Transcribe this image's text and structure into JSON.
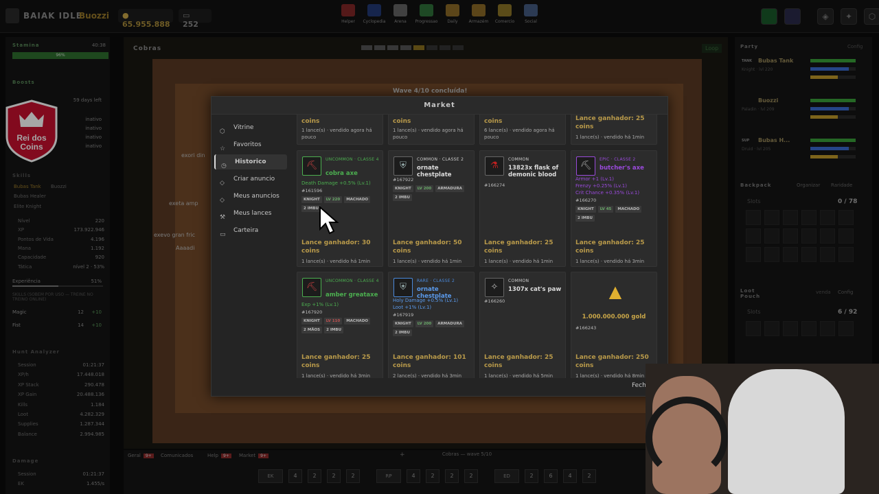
{
  "topbar": {
    "brand": "BAIAK IDLE",
    "player": "Buozzi",
    "gold": "65.955.888",
    "gems": "252",
    "nav": [
      {
        "label": "Helper",
        "icon": "heart-icon",
        "color": "#b03030"
      },
      {
        "label": "Cyclopedia",
        "icon": "book-icon",
        "color": "#2a4aa0"
      },
      {
        "label": "Arena",
        "icon": "swords-icon",
        "color": "#888888"
      },
      {
        "label": "Progressao",
        "icon": "chart-icon",
        "color": "#3a9a4a"
      },
      {
        "label": "Daily",
        "icon": "gift-icon",
        "color": "#c09030"
      },
      {
        "label": "Armazém",
        "icon": "chest-icon",
        "color": "#c09030"
      },
      {
        "label": "Comercio",
        "icon": "coins-icon",
        "color": "#c0a030"
      },
      {
        "label": "Social",
        "icon": "people-icon",
        "color": "#5a7ab0"
      }
    ]
  },
  "left": {
    "stamina_label": "Stamina",
    "stamina_time": "40:38",
    "stamina_pct": "96%",
    "boosts_label": "Boosts",
    "boost_days": "59 days left",
    "boost_states": [
      "inativo",
      "inativo",
      "inativo",
      "inativo"
    ],
    "skills_label": "Skills",
    "party_names": [
      "Bubas Tank",
      "Buozzi",
      "Bubas Healer"
    ],
    "vocation": "Elite Knight",
    "stats": [
      {
        "k": "Nível",
        "v": "220"
      },
      {
        "k": "XP",
        "v": "173.922.946"
      },
      {
        "k": "Pontos de Vida",
        "v": "4.196"
      },
      {
        "k": "Mana",
        "v": "1.192"
      },
      {
        "k": "Capacidade",
        "v": "920"
      },
      {
        "k": "Tática",
        "v": "nível 2 · 53%"
      }
    ],
    "exp_label": "Experiência",
    "exp_pct": "51%",
    "skills_note": "SKILLS (SOBEM POR USO — TREINE NO TREINO ONLINE)",
    "magic": {
      "k": "Magic",
      "v": "12",
      "bonus": "+10"
    },
    "fist": {
      "k": "Fist",
      "v": "14",
      "bonus": "+10"
    },
    "hunt_label": "Hunt Analyzer",
    "hunt": [
      {
        "k": "Session",
        "v": "01:21:37"
      },
      {
        "k": "XP/h",
        "v": "17.448.018"
      },
      {
        "k": "XP Stack",
        "v": "290.478"
      },
      {
        "k": "XP Gain",
        "v": "20.488.136"
      },
      {
        "k": "Kills",
        "v": "1.184"
      },
      {
        "k": "Loot",
        "v": "4.282.329"
      },
      {
        "k": "Supplies",
        "v": "1.287.344"
      },
      {
        "k": "Balance",
        "v": "2.994.985"
      }
    ],
    "damage_label": "Damage",
    "damage": [
      {
        "k": "Session",
        "v": "01:21:37"
      },
      {
        "k": "EK",
        "v": "1.455/s"
      }
    ]
  },
  "logo": {
    "line1": "Rei dos",
    "line2": "Coins"
  },
  "game": {
    "location": "Cobras",
    "wave_banner": "Wave 4/10 concluída!",
    "loop_label": "Loop",
    "overhead": [
      "exori din",
      "exeta amp",
      "exevo gran fric",
      "Aaaadi"
    ],
    "status_line": "Cobras — wave 5/10"
  },
  "right": {
    "party_label": "Party",
    "config_label": "Config",
    "members": [
      {
        "role": "TANK",
        "name": "Bubas Tank",
        "sub": "Knight · lvl 220"
      },
      {
        "role": "",
        "name": "Buozzi",
        "sub": "Paladin · lvl 209"
      },
      {
        "role": "SUP",
        "name": "Bubas H...",
        "sub": "Druid · lvl 205"
      }
    ],
    "backpack_label": "Backpack",
    "organizar": "Organizar",
    "raridade": "Raridade",
    "slots_label": "Slots",
    "backpack_slots": "0 / 78",
    "loot_label": "Loot Pouch",
    "venda": "venda",
    "loot_slots": "6 / 92",
    "config2": "Config"
  },
  "bottom": {
    "tabs": [
      {
        "label": "Geral",
        "badge": "9+"
      },
      {
        "label": "Comunicados",
        "badge": ""
      },
      {
        "label": "Help",
        "badge": "9+"
      },
      {
        "label": "Market",
        "badge": "9+"
      }
    ],
    "add_tab": "+",
    "hotkeys": [
      {
        "label": "EK",
        "nums": [
          "4",
          "2",
          "2",
          "2"
        ]
      },
      {
        "label": "RP",
        "nums": [
          "4",
          "2",
          "2",
          "2"
        ]
      },
      {
        "label": "ED",
        "nums": [
          "2",
          "6",
          "4",
          "2"
        ]
      }
    ]
  },
  "market": {
    "title": "Market",
    "close": "Fechar",
    "menu": [
      {
        "label": "Vitrine",
        "icon": "cube-icon"
      },
      {
        "label": "Favoritos",
        "icon": "star-icon"
      },
      {
        "label": "Historico",
        "icon": "clock-icon",
        "active": true
      },
      {
        "label": "Criar anuncio",
        "icon": "tag-icon"
      },
      {
        "label": "Meus anuncios",
        "icon": "tag-icon"
      },
      {
        "label": "Meus lances",
        "icon": "gavel-icon"
      },
      {
        "label": "Carteira",
        "icon": "wallet-icon"
      }
    ],
    "row0": [
      {
        "win": "coins",
        "meta": "1 lance(s) · vendido agora há pouco"
      },
      {
        "win": "coins",
        "meta": "1 lance(s) · vendido agora há pouco"
      },
      {
        "win": "coins",
        "meta": "6 lance(s) · vendido agora há pouco"
      },
      {
        "win": "Lance ganhador: 25 coins",
        "meta": "1 lance(s) · vendido há 1min"
      }
    ],
    "row1": [
      {
        "rarity": "UNCOMMON · CLASSE 4",
        "rarity_color": "#4caf50",
        "name": "cobra axe",
        "name_color": "#4caf50",
        "attrs": [
          "Death Damage +0.5% (Lv.1)"
        ],
        "id": "#161596",
        "tags": [
          "KNIGHT",
          "LV 220",
          "MACHADO",
          "2 IMBU"
        ],
        "win": "Lance ganhador: 30 coins",
        "meta": "1 lance(s) · vendido há 1min",
        "icon": "axe-icon",
        "icon_color": "#c04040",
        "border": "#4caf50"
      },
      {
        "rarity": "COMMON · CLASSE 2",
        "rarity_color": "#cfcfcf",
        "name": "ornate chestplate",
        "name_color": "#dcdcdc",
        "attrs": [],
        "id": "#167922",
        "tags": [
          "KNIGHT",
          "LV 200",
          "ARMADURA",
          "2 IMBU"
        ],
        "win": "Lance ganhador: 50 coins",
        "meta": "1 lance(s) · vendido há 1min",
        "icon": "armor-icon",
        "icon_color": "#9ab0b0",
        "border": "#666666"
      },
      {
        "rarity": "COMMON",
        "rarity_color": "#cfcfcf",
        "name": "13823x flask of demonic blood",
        "name_color": "#dcdcdc",
        "attrs": [],
        "id": "#166274",
        "tags": [],
        "win": "Lance ganhador: 25 coins",
        "meta": "1 lance(s) · vendido há 1min",
        "icon": "flask-icon",
        "icon_color": "#c02020",
        "border": "#666666"
      },
      {
        "rarity": "EPIC · CLASSE 2",
        "rarity_color": "#9a4adc",
        "name": "butcher's axe",
        "name_color": "#9a4adc",
        "attrs": [
          "Armor +1 (Lv.1)",
          "Frenzy +0.25% (Lv.1)",
          "Crit Chance +0.35% (Lv.1)"
        ],
        "id": "#166270",
        "tags": [
          "KNIGHT",
          "LV 45",
          "MACHADO",
          "2 IMBU"
        ],
        "win": "Lance ganhador: 25 coins",
        "meta": "1 lance(s) · vendido há 3min",
        "icon": "axe-icon",
        "icon_color": "#aaaaaa",
        "border": "#9a4adc"
      }
    ],
    "row2": [
      {
        "rarity": "UNCOMMON · CLASSE 4",
        "rarity_color": "#4caf50",
        "name": "amber greataxe",
        "name_color": "#4caf50",
        "attrs": [
          "Exp +1% (Lv.1)"
        ],
        "id": "#167920",
        "tags": [
          "KNIGHT",
          "LV 110",
          "MACHADO",
          "2 MÃOS",
          "2 IMBU"
        ],
        "win": "Lance ganhador: 25 coins",
        "meta": "1 lance(s) · vendido há 3min",
        "icon": "axe-icon",
        "icon_color": "#c04040",
        "border": "#4caf50"
      },
      {
        "rarity": "RARE · CLASSE 2",
        "rarity_color": "#4a8adc",
        "name": "ornate chestplate",
        "name_color": "#5a9aec",
        "attrs": [
          "Holy Damage +0.5% (Lv.1)",
          "Loot +1% (Lv.1)"
        ],
        "id": "#167919",
        "tags": [
          "KNIGHT",
          "LV 200",
          "ARMADURA",
          "2 IMBU"
        ],
        "win": "Lance ganhador: 101 coins",
        "meta": "2 lance(s) · vendido há 3min",
        "icon": "armor-icon",
        "icon_color": "#9ab0b0",
        "border": "#4a8adc"
      },
      {
        "rarity": "COMMON",
        "rarity_color": "#cfcfcf",
        "name": "1307x cat's paw",
        "name_color": "#dcdcdc",
        "attrs": [],
        "id": "#166260",
        "tags": [],
        "win": "Lance ganhador: 25 coins",
        "meta": "1 lance(s) · vendido há 5min",
        "icon": "paw-icon",
        "icon_color": "#bbbbbb",
        "border": "#666666"
      },
      {
        "rarity": "",
        "rarity_color": "#cfcfcf",
        "name": "1.000.000.000 gold",
        "name_color": "#c9a648",
        "attrs": [],
        "id": "#166243",
        "tags": [],
        "win": "Lance ganhador: 250 coins",
        "meta": "1 lance(s) · vendido há 8min",
        "icon": "gold-icon",
        "icon_color": "#e0b030",
        "border": "transparent",
        "centered": true
      }
    ]
  }
}
